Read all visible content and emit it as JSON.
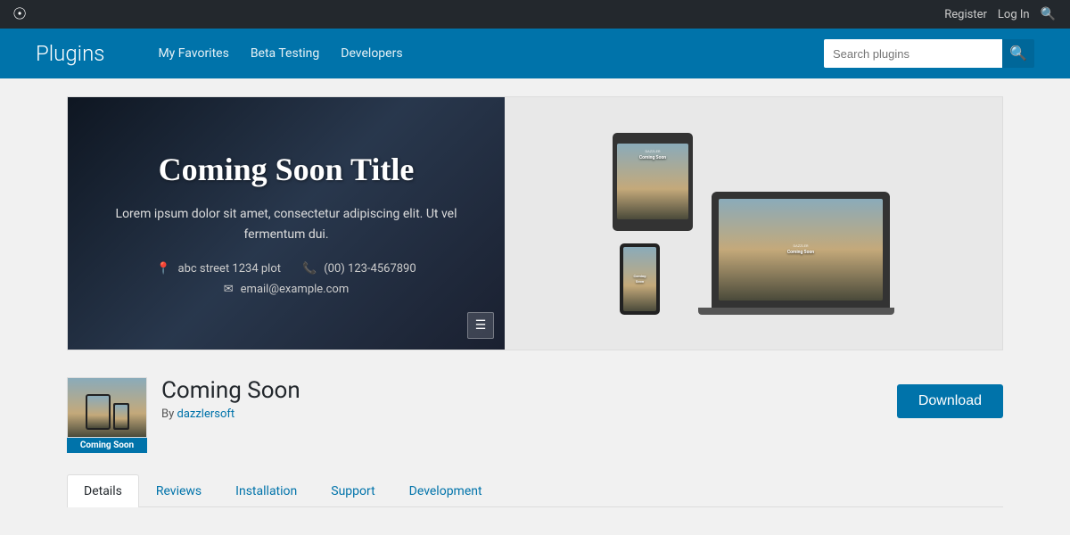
{
  "topbar": {
    "register_label": "Register",
    "login_label": "Log In"
  },
  "header": {
    "title": "Plugins",
    "nav": {
      "my_favorites": "My Favorites",
      "beta_testing": "Beta Testing",
      "developers": "Developers"
    },
    "search_placeholder": "Search plugins"
  },
  "hero": {
    "title": "Coming Soon Title",
    "description": "Lorem ipsum dolor sit amet, consectetur adipiscing elit. Ut vel fermentum dui.",
    "address": "abc street 1234 plot",
    "phone": "(00) 123-4567890",
    "email": "email@example.com",
    "right_label": "Coming Soon",
    "brand": "DAZZLER"
  },
  "plugin": {
    "name": "Coming Soon",
    "author_prefix": "By",
    "author": "dazzlersoft",
    "icon_label": "Coming Soon",
    "download_label": "Download"
  },
  "tabs": [
    {
      "label": "Details",
      "active": true
    },
    {
      "label": "Reviews",
      "active": false
    },
    {
      "label": "Installation",
      "active": false
    },
    {
      "label": "Support",
      "active": false
    },
    {
      "label": "Development",
      "active": false
    }
  ]
}
